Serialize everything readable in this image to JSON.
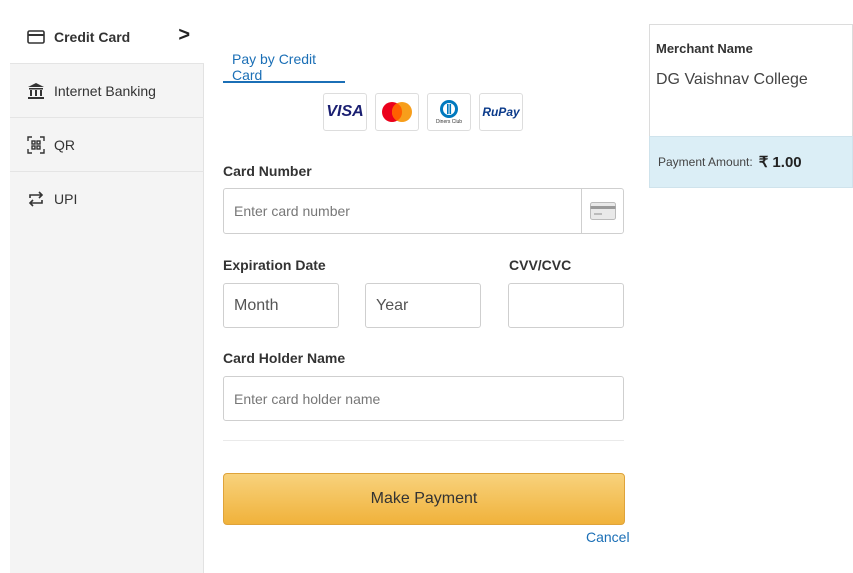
{
  "sidebar": {
    "items": [
      {
        "label": "Credit Card",
        "icon": "credit-card-icon"
      },
      {
        "label": "Internet Banking",
        "icon": "bank-icon"
      },
      {
        "label": "QR",
        "icon": "qr-icon"
      },
      {
        "label": "UPI",
        "icon": "upi-icon"
      }
    ],
    "active_chevron": ">"
  },
  "main": {
    "tab_label": "Pay by Credit Card",
    "card_logos": [
      "VISA",
      "Mastercard",
      "Diners Club",
      "RuPay"
    ],
    "visa_text": "VISA",
    "rupay_text": "RuPay",
    "diners_text": "Diners Club",
    "card_number_label": "Card Number",
    "card_number_placeholder": "Enter card number",
    "expiration_label": "Expiration Date",
    "month_placeholder": "Month",
    "year_placeholder": "Year",
    "cvv_label": "CVV/CVC",
    "holder_label": "Card Holder Name",
    "holder_placeholder": "Enter card holder name",
    "pay_button": "Make Payment",
    "cancel": "Cancel"
  },
  "merchant": {
    "label": "Merchant Name",
    "name": "DG Vaishnav College",
    "amount_label": "Payment Amount:",
    "amount_value": "₹ 1.00"
  },
  "colors": {
    "accent": "#1b6fb6",
    "button": "#f0b23b",
    "amount_bg": "#dbeef6"
  }
}
